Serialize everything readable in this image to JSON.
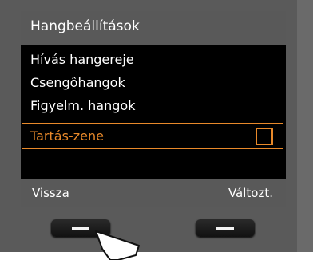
{
  "screen": {
    "title": "Hangbeállítások",
    "menu_items": [
      {
        "label": "Hívás hangereje"
      },
      {
        "label": "Csengôhangok"
      },
      {
        "label": "Figyelm. hangok"
      }
    ],
    "selected_item": {
      "label": "Tartás-zene",
      "checked": false
    },
    "softkeys": {
      "left": "Vissza",
      "right": "Változt."
    }
  },
  "colors": {
    "accent": "#e8892a",
    "title_bg": "#595959",
    "screen_bg": "#000000"
  },
  "icons": {
    "pointer": "arrow-pointer-icon",
    "checkbox": "checkbox-icon"
  }
}
